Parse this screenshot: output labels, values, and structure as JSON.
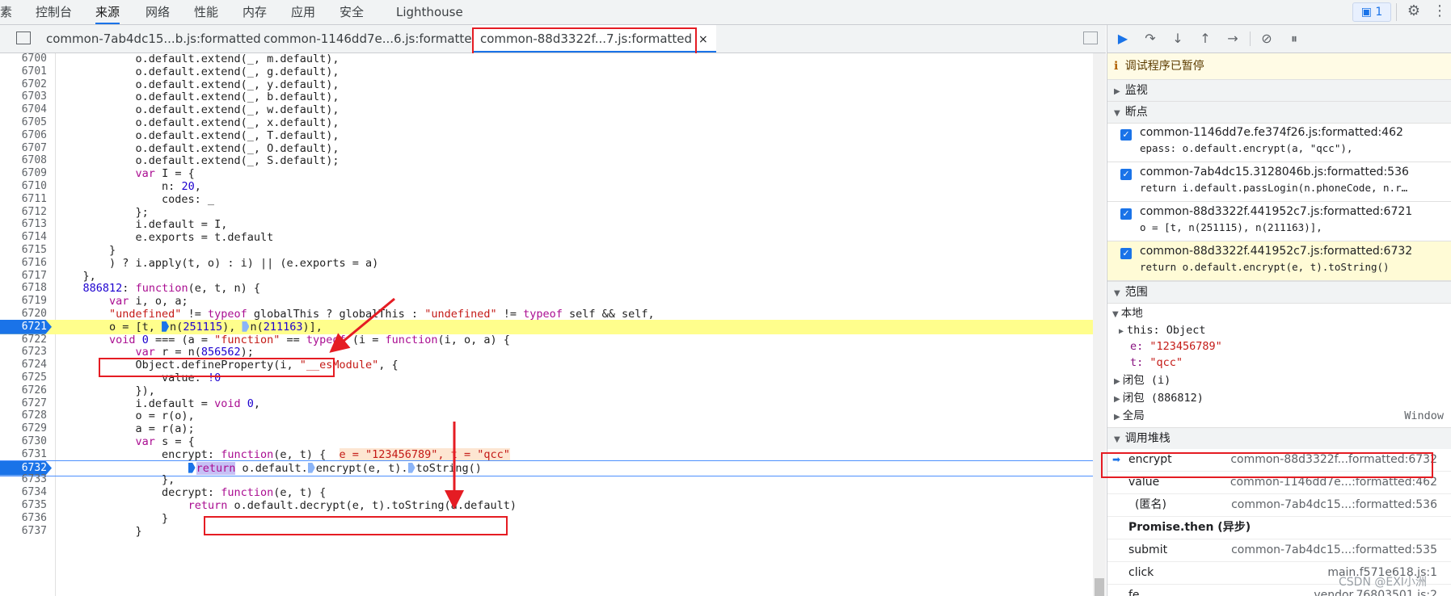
{
  "topnav": {
    "items": [
      "素",
      "控制台",
      "来源",
      "网络",
      "性能",
      "内存",
      "应用",
      "安全",
      "Lighthouse"
    ],
    "active_index": 2,
    "message_count": "1"
  },
  "file_tabs": [
    {
      "label": "common-7ab4dc15...b.js:formatted",
      "active": false
    },
    {
      "label": "common-1146dd7e...6.js:formatted",
      "active": false
    },
    {
      "label": "common-88d3322f...7.js:formatted",
      "active": true,
      "close": "×"
    }
  ],
  "code": {
    "lines": [
      {
        "n": "6700",
        "t": "            o.default.extend(_, m.default),"
      },
      {
        "n": "6701",
        "t": "            o.default.extend(_, g.default),"
      },
      {
        "n": "6702",
        "t": "            o.default.extend(_, y.default),"
      },
      {
        "n": "6703",
        "t": "            o.default.extend(_, b.default),"
      },
      {
        "n": "6704",
        "t": "            o.default.extend(_, w.default),"
      },
      {
        "n": "6705",
        "t": "            o.default.extend(_, x.default),"
      },
      {
        "n": "6706",
        "t": "            o.default.extend(_, T.default),"
      },
      {
        "n": "6707",
        "t": "            o.default.extend(_, O.default),"
      },
      {
        "n": "6708",
        "t": "            o.default.extend(_, S.default);"
      },
      {
        "n": "6709",
        "t": "            var I = {"
      },
      {
        "n": "6710",
        "t": "                n: 20,"
      },
      {
        "n": "6711",
        "t": "                codes: _"
      },
      {
        "n": "6712",
        "t": "            };"
      },
      {
        "n": "6713",
        "t": "            i.default = I,"
      },
      {
        "n": "6714",
        "t": "            e.exports = t.default"
      },
      {
        "n": "6715",
        "t": "        }"
      },
      {
        "n": "6716",
        "t": "        ) ? i.apply(t, o) : i) || (e.exports = a)"
      },
      {
        "n": "6717",
        "t": "    },"
      },
      {
        "n": "6718",
        "t": "    886812: function(e, t, n) {"
      },
      {
        "n": "6719",
        "t": "        var i, o, a;"
      },
      {
        "n": "6720",
        "t": "        \"undefined\" != typeof globalThis ? globalThis : \"undefined\" != typeof self && self,"
      },
      {
        "n": "6721",
        "t": "        o = [t, n(251115), n(211163)],"
      },
      {
        "n": "6722",
        "t": "        void 0 === (a = \"function\" == typeof (i = function(i, o, a) {"
      },
      {
        "n": "6723",
        "t": "            var r = n(856562);"
      },
      {
        "n": "6724",
        "t": "            Object.defineProperty(i, \"__esModule\", {"
      },
      {
        "n": "6725",
        "t": "                value: !0"
      },
      {
        "n": "6726",
        "t": "            }),"
      },
      {
        "n": "6727",
        "t": "            i.default = void 0,"
      },
      {
        "n": "6728",
        "t": "            o = r(o),"
      },
      {
        "n": "6729",
        "t": "            a = r(a);"
      },
      {
        "n": "6730",
        "t": "            var s = {"
      },
      {
        "n": "6731",
        "t": "                encrypt: function(e, t) {"
      },
      {
        "n": "6732",
        "t": "                    return o.default.encrypt(e, t).toString()"
      },
      {
        "n": "6733",
        "t": "                },"
      },
      {
        "n": "6734",
        "t": "                decrypt: function(e, t) {"
      },
      {
        "n": "6735",
        "t": "                    return o.default.decrypt(e, t).toString(a.default)"
      },
      {
        "n": "6736",
        "t": "                }"
      },
      {
        "n": "6737",
        "t": "            }"
      }
    ],
    "inline_values": "e = \"123456789\", t = \"qcc\""
  },
  "debugger": {
    "paused_text": "调试程序已暂停",
    "sections": {
      "watch": "监视",
      "breakpoints": "断点",
      "scope": "范围",
      "callstack": "调用堆栈"
    },
    "breakpoints": [
      {
        "file": "common-1146dd7e.fe374f26.js:formatted:462",
        "code": "epass: o.default.encrypt(a, \"qcc\"),"
      },
      {
        "file": "common-7ab4dc15.3128046b.js:formatted:536",
        "code": "return i.default.passLogin(n.phoneCode, n.r…"
      },
      {
        "file": "common-88d3322f.441952c7.js:formatted:6721",
        "code": "o = [t, n(251115), n(211163)],"
      },
      {
        "file": "common-88d3322f.441952c7.js:formatted:6732",
        "code": "return o.default.encrypt(e, t).toString()"
      }
    ],
    "scope": {
      "local_label": "本地",
      "this_label": "this: Object",
      "e_key": "e:",
      "e_val": "\"123456789\"",
      "t_key": "t:",
      "t_val": "\"qcc\"",
      "closure1": "闭包 (i)",
      "closure2": "闭包 (886812)",
      "global": "全局",
      "global_val": "Window"
    },
    "callstack": [
      {
        "fn": "encrypt",
        "loc": "common-88d3322f...formatted:6732",
        "current": true
      },
      {
        "fn": "value",
        "loc": "common-1146dd7e...:formatted:462"
      },
      {
        "fn": "(匿名)",
        "loc": "common-7ab4dc15...:formatted:536"
      },
      {
        "fn": "Promise.then (异步)",
        "loc": "",
        "async": true
      },
      {
        "fn": "submit",
        "loc": "common-7ab4dc15...:formatted:535"
      },
      {
        "fn": "click",
        "loc": "main.f571e618.js:1"
      },
      {
        "fn": "fe",
        "loc": "vendor.76803501.js:2"
      }
    ]
  },
  "watermark": "CSDN @EXI小洲"
}
